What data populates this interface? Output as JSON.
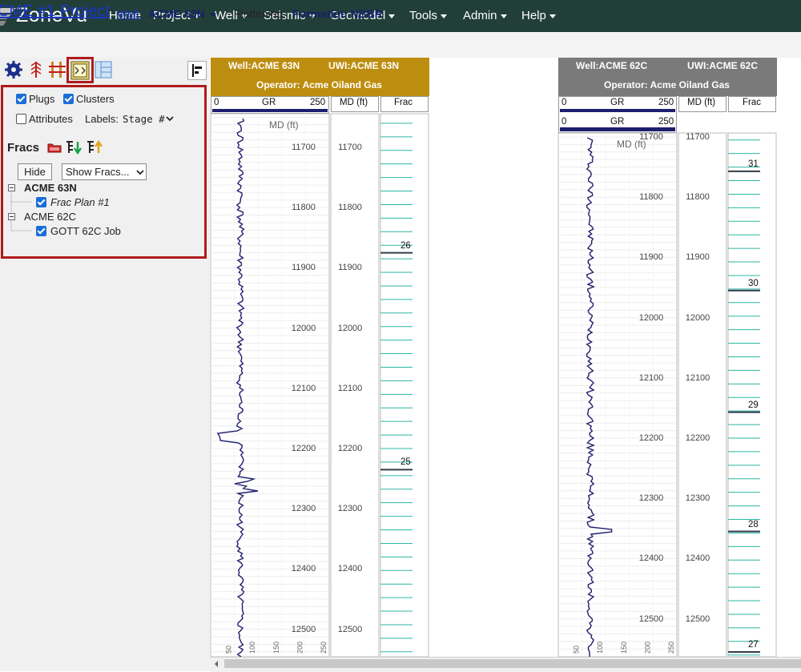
{
  "app": {
    "brand": "ZoneVu",
    "nav": [
      {
        "label": "Home",
        "dropdown": false
      },
      {
        "label": "Project",
        "dropdown": true
      },
      {
        "label": "Well",
        "dropdown": true
      },
      {
        "label": "Seismic",
        "dropdown": true
      },
      {
        "label": "Geomodel",
        "dropdown": true
      },
      {
        "label": "Tools",
        "dropdown": true
      },
      {
        "label": "Admin",
        "dropdown": true
      },
      {
        "label": "Help",
        "dropdown": true
      }
    ]
  },
  "header": {
    "project_title": "CME #1 Project",
    "well_label": "Well:",
    "well_value": "ACME 63N",
    "flattening_label": "Flattening:",
    "flattening_value": "Formation  NBBR"
  },
  "toolbar": {
    "icons": [
      "gear-icon",
      "well-marker-icon",
      "correlation-icon",
      "frac-icon",
      "layout-icon",
      "align-left-icon"
    ]
  },
  "frac_options": {
    "plugs_label": "Plugs",
    "plugs_checked": true,
    "clusters_label": "Clusters",
    "clusters_checked": true,
    "attributes_label": "Attributes",
    "attributes_checked": false,
    "labels_label": "Labels:",
    "labels_value": "Stage #",
    "section_title": "Fracs",
    "hide_button": "Hide",
    "show_select": "Show Fracs...",
    "tree": [
      {
        "well": "ACME 63N",
        "bold": true,
        "child": "Frac Plan #1",
        "child_italic": true,
        "checked": true
      },
      {
        "well": "ACME 62C",
        "bold": false,
        "child": "GOTT 62C Job",
        "child_italic": false,
        "checked": true
      }
    ]
  },
  "wells": [
    {
      "well_header": "Well:ACME 63N",
      "uwi_header": "UWI:ACME 63N",
      "operator": "Operator: Acme Oiland Gas",
      "header_color": "#bd8d0f",
      "gr_min": "0",
      "gr_label": "GR",
      "gr_max": "250",
      "md_label": "MD (ft)",
      "frac_label": "Frac",
      "md_axis_label": "MD (ft)",
      "depths": [
        "11700",
        "11800",
        "11900",
        "12000",
        "12100",
        "12200",
        "12300",
        "12400",
        "12500"
      ],
      "stages": [
        {
          "number": "26",
          "depth": 11875
        },
        {
          "number": "25",
          "depth": 12235
        }
      ],
      "gr_ticks": [
        "50",
        "100",
        "150",
        "200",
        "250"
      ]
    },
    {
      "well_header": "Well:ACME 62C",
      "uwi_header": "UWI:ACME 62C",
      "operator": "Operator: Acme Oiland Gas",
      "header_color": "#7a7a7a",
      "gr_min": "0",
      "gr_label": "GR",
      "gr_max": "250",
      "md_label": "MD (ft)",
      "frac_label": "Frac",
      "md_axis_label": "MD (ft)",
      "depths": [
        "11700",
        "11800",
        "11900",
        "12000",
        "12100",
        "12200",
        "12300",
        "12400",
        "12500"
      ],
      "stages": [
        {
          "number": "31",
          "depth": 11757
        },
        {
          "number": "30",
          "depth": 11955
        },
        {
          "number": "29",
          "depth": 12157
        },
        {
          "number": "28",
          "depth": 12355
        },
        {
          "number": "27",
          "depth": 12555
        }
      ],
      "gr_ticks": [
        "50",
        "100",
        "150",
        "200",
        "250"
      ]
    }
  ],
  "colors": {
    "nav_bg": "#213f38",
    "highlight_red": "#b01b1b",
    "link_blue": "#1a35c9",
    "frac_teal": "#2bb7a5",
    "gr_curve": "#1e1e6e"
  }
}
